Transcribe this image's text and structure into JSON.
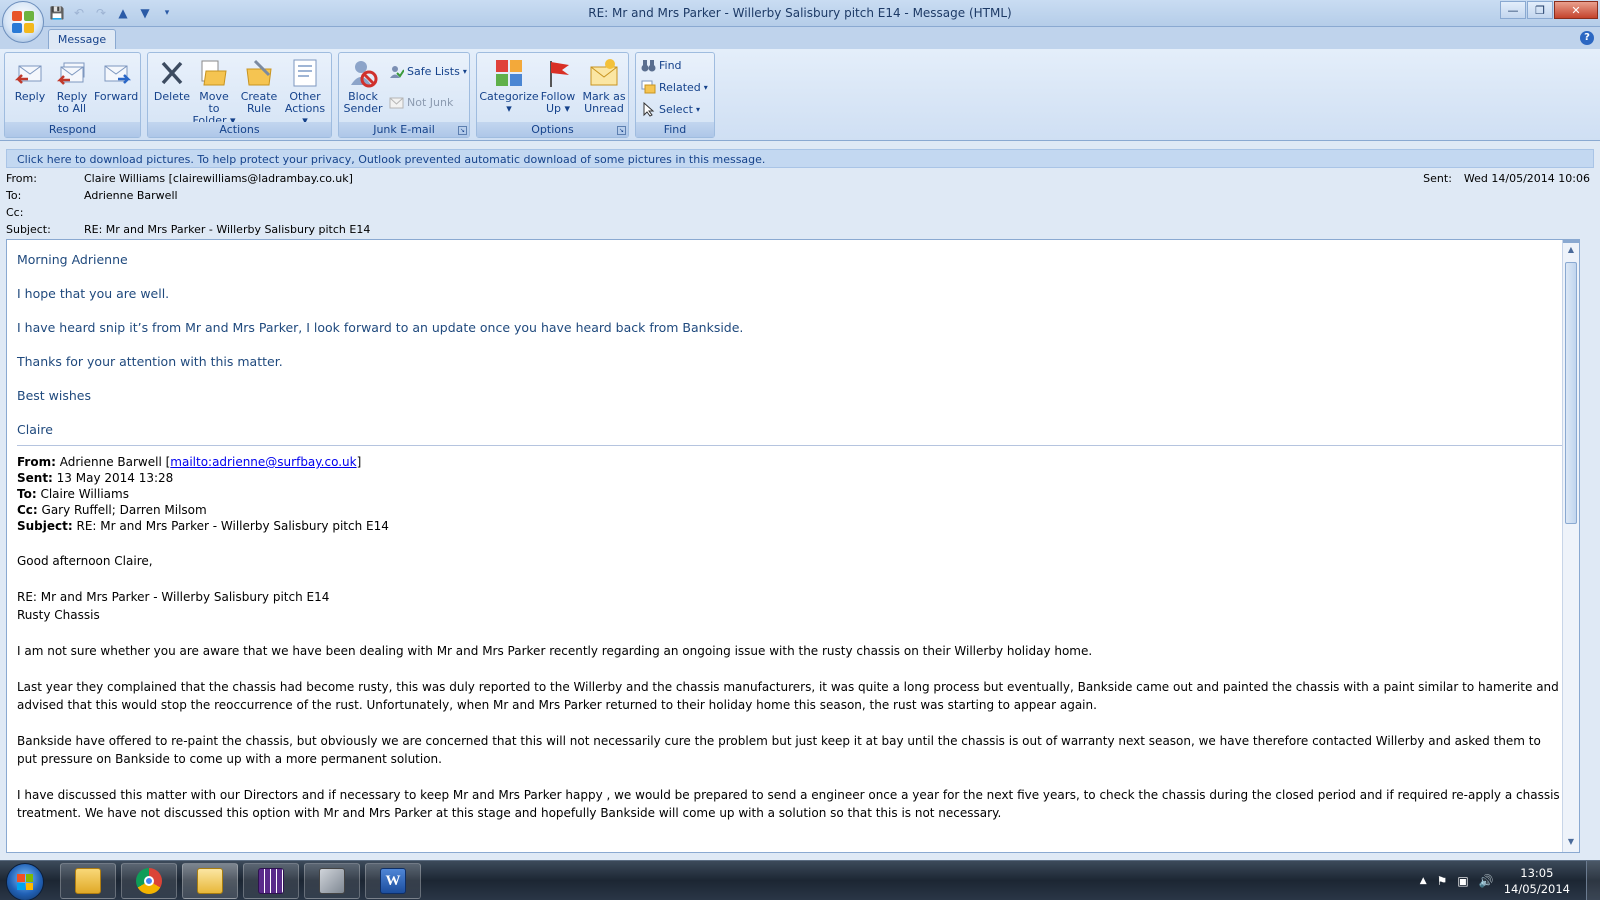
{
  "window": {
    "title": "RE: Mr and Mrs Parker - Willerby Salisbury pitch E14  -  Message (HTML)"
  },
  "tabs": {
    "message": "Message"
  },
  "ribbon": {
    "respond": {
      "label": "Respond",
      "reply": "Reply",
      "reply_all_1": "Reply",
      "reply_all_2": "to All",
      "forward": "Forward"
    },
    "actions": {
      "label": "Actions",
      "delete": "Delete",
      "move_1": "Move to",
      "move_2": "Folder",
      "rule_1": "Create",
      "rule_2": "Rule",
      "other_1": "Other",
      "other_2": "Actions"
    },
    "junk": {
      "label": "Junk E-mail",
      "block_1": "Block",
      "block_2": "Sender",
      "safe_lists": "Safe Lists",
      "not_junk": "Not Junk"
    },
    "options": {
      "label": "Options",
      "categorize": "Categorize",
      "follow_1": "Follow",
      "follow_2": "Up",
      "mark_1": "Mark as",
      "mark_2": "Unread"
    },
    "find": {
      "label": "Find",
      "find": "Find",
      "related": "Related",
      "select": "Select"
    }
  },
  "infobar": "Click here to download pictures. To help protect your privacy, Outlook prevented automatic download of some pictures in this message.",
  "header": {
    "from_label": "From:",
    "from_value": "Claire Williams [clairewilliams@ladrambay.co.uk]",
    "to_label": "To:",
    "to_value": "Adrienne Barwell",
    "cc_label": "Cc:",
    "subject_label": "Subject:",
    "subject_value": "RE: Mr and Mrs Parker - Willerby Salisbury pitch E14",
    "sent_label": "Sent:",
    "sent_value": "Wed 14/05/2014 10:06"
  },
  "reply": {
    "greeting": "Morning Adrienne",
    "line1": "I hope that you are well.",
    "line2": "I have heard snip it’s from Mr and Mrs Parker, I look forward to an update once you have heard back from Bankside.",
    "line3": "Thanks for your attention with this matter.",
    "signoff": "Best wishes",
    "name": "Claire"
  },
  "original": {
    "from_label": "From:",
    "from_name": " Adrienne Barwell [",
    "from_link": "mailto:adrienne@surfbay.co.uk",
    "from_close": "]",
    "sent_label": "Sent:",
    "sent_value": " 13 May 2014 13:28",
    "to_label": "To:",
    "to_value": " Claire Williams",
    "cc_label": "Cc:",
    "cc_value": " Gary Ruffell; Darren Milsom",
    "subject_label": "Subject:",
    "subject_value": " RE: Mr and Mrs Parker - Willerby Salisbury pitch E14",
    "greeting": "Good afternoon Claire,",
    "re_line": "RE: Mr and Mrs Parker - Willerby Salisbury pitch E14",
    "re_sub": "Rusty Chassis",
    "p1": "I am not sure whether you are aware that we have been dealing with Mr and Mrs Parker recently regarding an ongoing issue with the rusty chassis on their Willerby holiday home.",
    "p2": "Last year they complained that the chassis had become rusty, this was duly reported to the Willerby and the chassis manufacturers, it was quite a long process but eventually, Bankside came out and painted the  chassis with a paint similar to hamerite and advised that this would stop the reoccurrence of the rust.  Unfortunately, when Mr and Mrs Parker returned to their holiday home this season, the rust was starting to appear again.",
    "p3": "Bankside have offered to re-paint the chassis, but obviously we are concerned that this will not necessarily  cure the problem but just keep it at bay until the chassis is out of warranty next season, we have therefore contacted Willerby and asked them to put pressure on Bankside to come up with a more permanent solution.",
    "p4": "I have discussed this matter with our Directors and if necessary to keep Mr and Mrs Parker happy , we would be prepared  to send a engineer once a year for the next five years, to check the chassis during the closed period and if required re-apply a chassis treatment.  We have not discussed this option with Mr and Mrs Parker at this stage and  hopefully Bankside will come up with a solution so that this is not  necessary."
  },
  "taskbar": {
    "apps": [
      "windows-explorer",
      "google-chrome",
      "outlook",
      "calendar-app",
      "tools-app",
      "microsoft-word"
    ],
    "time": "13:05",
    "date": "14/05/2014"
  },
  "colors": {
    "reply_text": "#1f497d",
    "link": "#0000ee",
    "ribbon_text": "#15428b"
  }
}
